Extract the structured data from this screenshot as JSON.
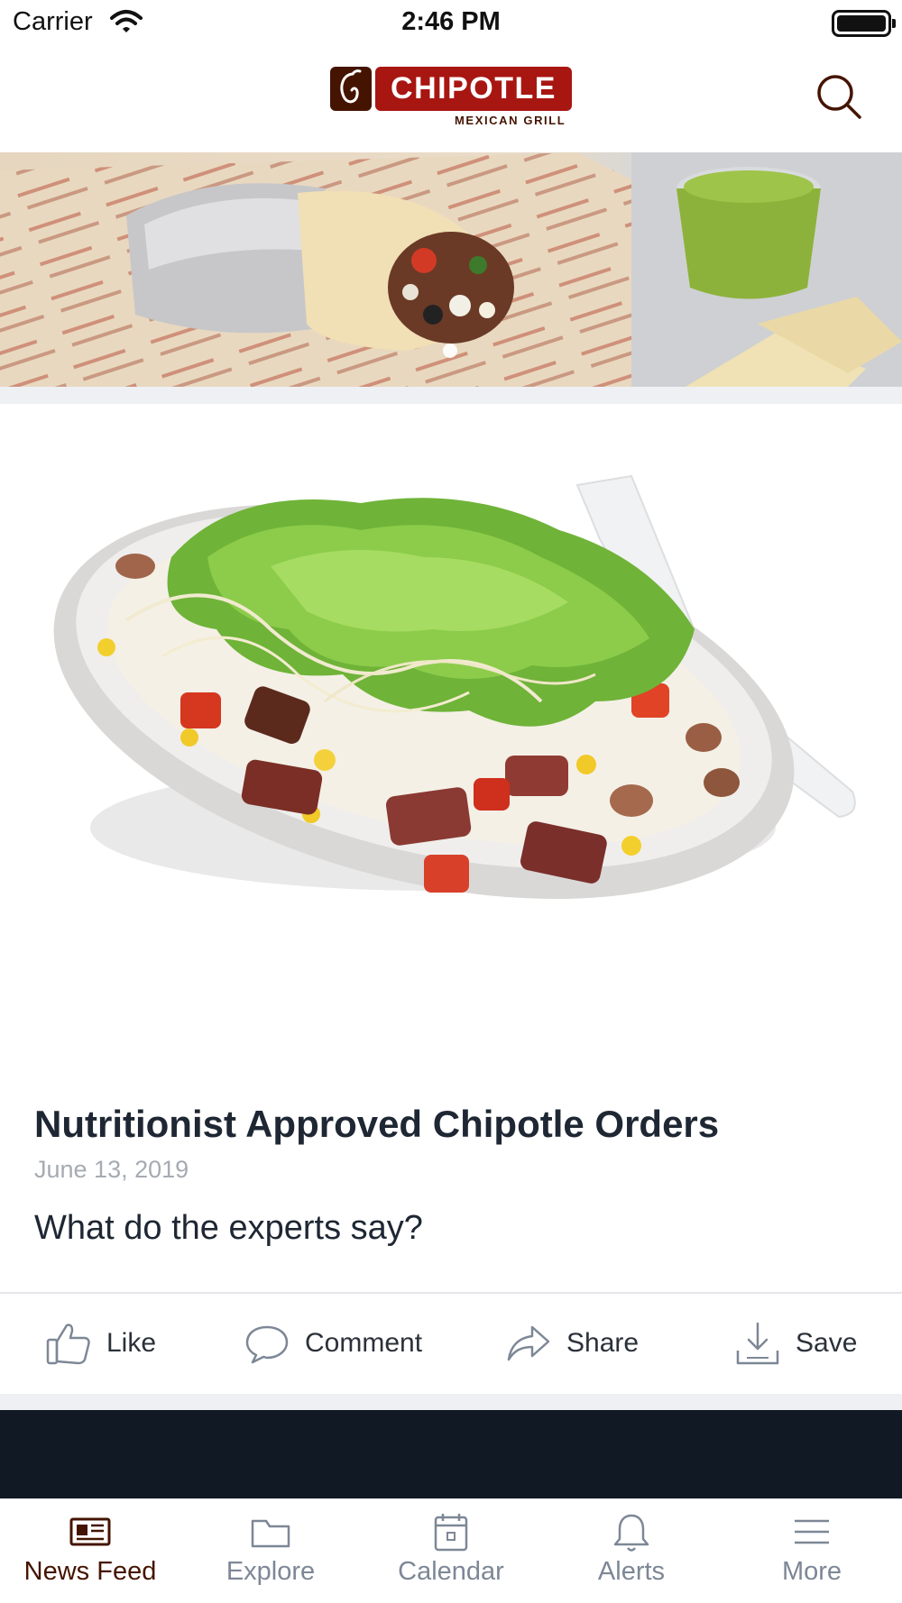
{
  "status_bar": {
    "carrier": "Carrier",
    "time": "2:46 PM"
  },
  "header": {
    "logo_wordmark": "CHIPOTLE",
    "logo_subtitle": "MEXICAN GRILL",
    "search_icon": "search-icon"
  },
  "banner": {
    "image": "burrito-and-guacamole-photo",
    "pager_dots": 1
  },
  "post": {
    "image": "burrito-bowl-photo",
    "title": "Nutritionist Approved Chipotle Orders",
    "date": "June 13, 2019",
    "description": "What do the experts say?",
    "actions": [
      {
        "label": "Like",
        "icon": "thumbs-up-icon"
      },
      {
        "label": "Comment",
        "icon": "speech-bubble-icon"
      },
      {
        "label": "Share",
        "icon": "share-arrow-icon"
      },
      {
        "label": "Save",
        "icon": "download-tray-icon"
      }
    ]
  },
  "tab_bar": {
    "tabs": [
      {
        "label": "News Feed",
        "icon": "newspaper-icon",
        "active": true
      },
      {
        "label": "Explore",
        "icon": "folder-icon",
        "active": false
      },
      {
        "label": "Calendar",
        "icon": "calendar-icon",
        "active": false
      },
      {
        "label": "Alerts",
        "icon": "bell-icon",
        "active": false
      },
      {
        "label": "More",
        "icon": "hamburger-menu-icon",
        "active": false
      }
    ]
  },
  "colors": {
    "brand_red": "#a81612",
    "brand_brown": "#451400",
    "text_dark": "#1e2733",
    "text_muted": "#a6abb2",
    "tab_inactive": "#7d8796",
    "separator": "#eef0f4",
    "dark_card": "#111925"
  }
}
